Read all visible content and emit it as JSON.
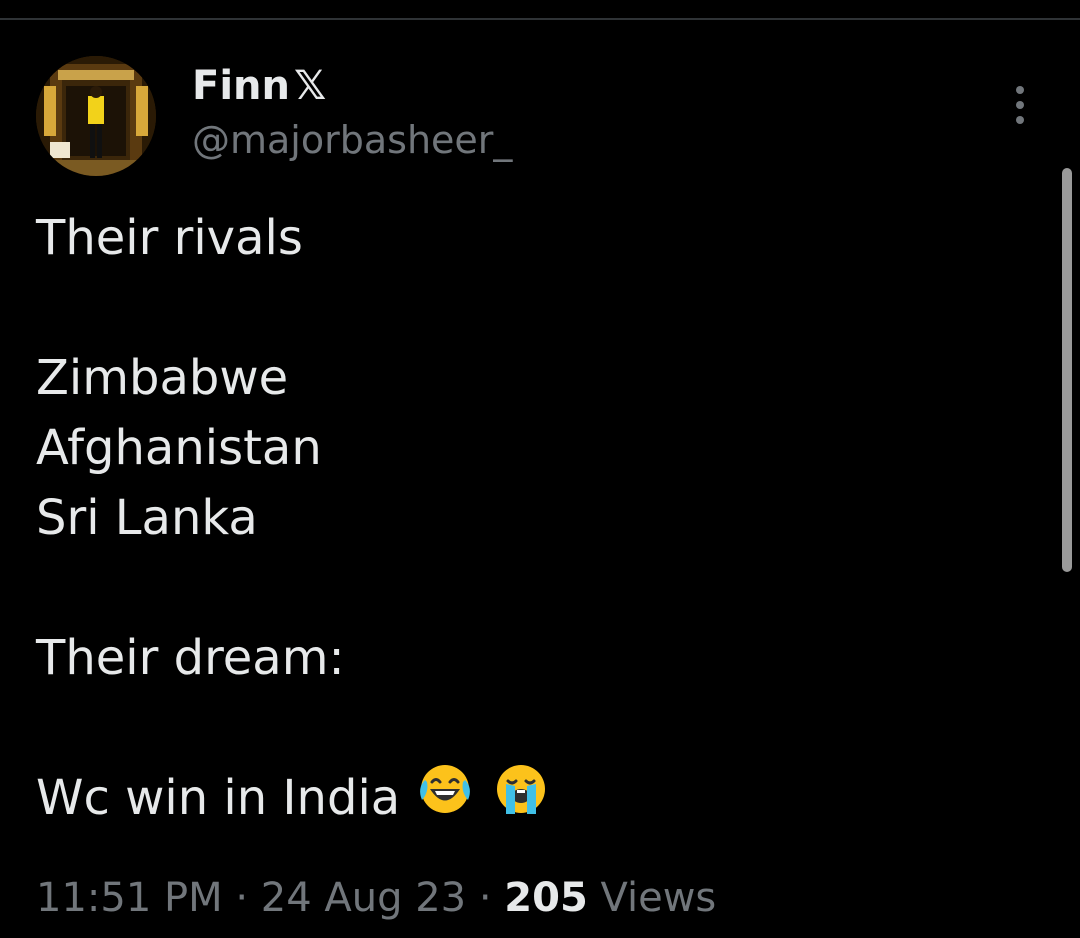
{
  "author": {
    "display_name": "Finn",
    "badge_glyph": "𝕏",
    "handle": "@majorbasheer_"
  },
  "tweet": {
    "lines": [
      "Their rivals",
      "Zimbabwe",
      "Afghanistan",
      "Sri Lanka",
      "Their dream:",
      "Wc win in India"
    ],
    "emojis": [
      "face-with-tears-of-joy",
      "loudly-crying-face"
    ]
  },
  "meta": {
    "time": "11:51 PM",
    "separator": "·",
    "date": "24 Aug 23",
    "views_count": "205",
    "views_label": "Views"
  },
  "colors": {
    "background": "#000000",
    "text_primary": "#e7e9ea",
    "text_secondary": "#71767b"
  }
}
